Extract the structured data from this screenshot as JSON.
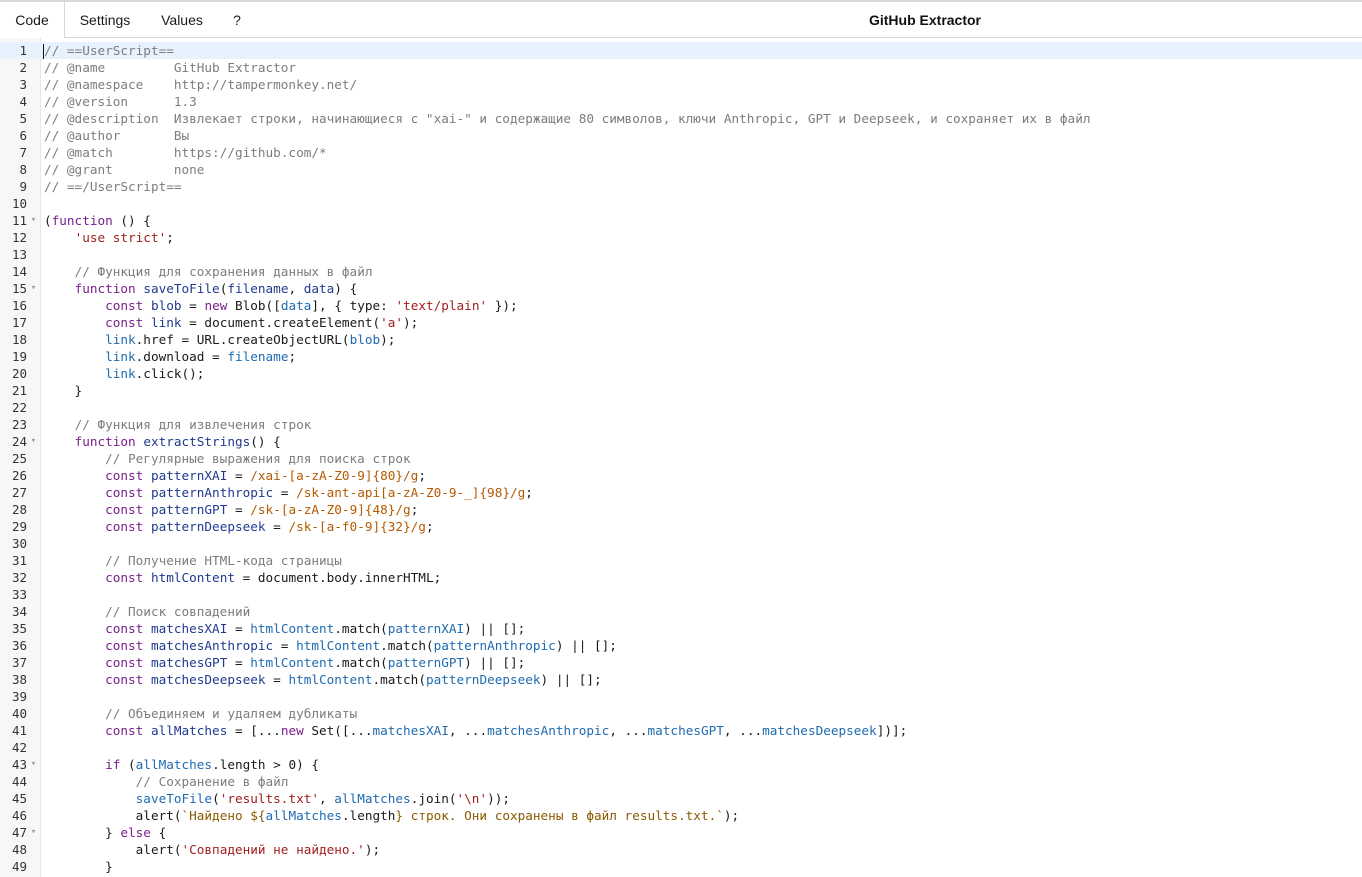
{
  "tabs": [
    {
      "label": "Code",
      "active": true
    },
    {
      "label": "Settings",
      "active": false
    },
    {
      "label": "Values",
      "active": false
    },
    {
      "label": "?",
      "active": false
    }
  ],
  "script_title": "GitHub Extractor",
  "editor": {
    "active_line": 1,
    "fold_lines": [
      11,
      15,
      24,
      43,
      47
    ],
    "lines": [
      [
        [
          "com",
          "// ==UserScript=="
        ]
      ],
      [
        [
          "com",
          "// @name         GitHub Extractor"
        ]
      ],
      [
        [
          "com",
          "// @namespace    http://tampermonkey.net/"
        ]
      ],
      [
        [
          "com",
          "// @version      1.3"
        ]
      ],
      [
        [
          "com",
          "// @description  Извлекает строки, начинающиеся с \"xai-\" и содержащие 80 символов, ключи Anthropic, GPT и Deepseek, и сохраняет их в файл"
        ]
      ],
      [
        [
          "com",
          "// @author       Вы"
        ]
      ],
      [
        [
          "com",
          "// @match        https://github.com/*"
        ]
      ],
      [
        [
          "com",
          "// @grant        none"
        ]
      ],
      [
        [
          "com",
          "// ==/UserScript=="
        ]
      ],
      [],
      [
        [
          "p",
          "("
        ],
        [
          "kw",
          "function"
        ],
        [
          "p",
          " () {"
        ]
      ],
      [
        [
          "p",
          "    "
        ],
        [
          "str",
          "'use strict'"
        ],
        [
          "p",
          ";"
        ]
      ],
      [],
      [
        [
          "p",
          "    "
        ],
        [
          "com",
          "// Функция для сохранения данных в файл"
        ]
      ],
      [
        [
          "p",
          "    "
        ],
        [
          "kw",
          "function"
        ],
        [
          "p",
          " "
        ],
        [
          "def",
          "saveToFile"
        ],
        [
          "p",
          "("
        ],
        [
          "def",
          "filename"
        ],
        [
          "p",
          ", "
        ],
        [
          "def",
          "data"
        ],
        [
          "p",
          ") {"
        ]
      ],
      [
        [
          "p",
          "        "
        ],
        [
          "kw",
          "const"
        ],
        [
          "p",
          " "
        ],
        [
          "def",
          "blob"
        ],
        [
          "p",
          " = "
        ],
        [
          "kw",
          "new"
        ],
        [
          "p",
          " Blob(["
        ],
        [
          "var",
          "data"
        ],
        [
          "p",
          "], { type: "
        ],
        [
          "str",
          "'text/plain'"
        ],
        [
          "p",
          " });"
        ]
      ],
      [
        [
          "p",
          "        "
        ],
        [
          "kw",
          "const"
        ],
        [
          "p",
          " "
        ],
        [
          "def",
          "link"
        ],
        [
          "p",
          " = document.createElement("
        ],
        [
          "str",
          "'a'"
        ],
        [
          "p",
          ");"
        ]
      ],
      [
        [
          "p",
          "        "
        ],
        [
          "var",
          "link"
        ],
        [
          "p",
          ".href = URL.createObjectURL("
        ],
        [
          "var",
          "blob"
        ],
        [
          "p",
          ");"
        ]
      ],
      [
        [
          "p",
          "        "
        ],
        [
          "var",
          "link"
        ],
        [
          "p",
          ".download = "
        ],
        [
          "var",
          "filename"
        ],
        [
          "p",
          ";"
        ]
      ],
      [
        [
          "p",
          "        "
        ],
        [
          "var",
          "link"
        ],
        [
          "p",
          ".click();"
        ]
      ],
      [
        [
          "p",
          "    }"
        ]
      ],
      [],
      [
        [
          "p",
          "    "
        ],
        [
          "com",
          "// Функция для извлечения строк"
        ]
      ],
      [
        [
          "p",
          "    "
        ],
        [
          "kw",
          "function"
        ],
        [
          "p",
          " "
        ],
        [
          "def",
          "extractStrings"
        ],
        [
          "p",
          "() {"
        ]
      ],
      [
        [
          "p",
          "        "
        ],
        [
          "com",
          "// Регулярные выражения для поиска строк"
        ]
      ],
      [
        [
          "p",
          "        "
        ],
        [
          "kw",
          "const"
        ],
        [
          "p",
          " "
        ],
        [
          "def",
          "patternXAI"
        ],
        [
          "p",
          " = "
        ],
        [
          "re",
          "/xai-[a-zA-Z0-9]{80}/g"
        ],
        [
          "p",
          ";"
        ]
      ],
      [
        [
          "p",
          "        "
        ],
        [
          "kw",
          "const"
        ],
        [
          "p",
          " "
        ],
        [
          "def",
          "patternAnthropic"
        ],
        [
          "p",
          " = "
        ],
        [
          "re",
          "/sk-ant-api[a-zA-Z0-9-_]{98}/g"
        ],
        [
          "p",
          ";"
        ]
      ],
      [
        [
          "p",
          "        "
        ],
        [
          "kw",
          "const"
        ],
        [
          "p",
          " "
        ],
        [
          "def",
          "patternGPT"
        ],
        [
          "p",
          " = "
        ],
        [
          "re",
          "/sk-[a-zA-Z0-9]{48}/g"
        ],
        [
          "p",
          ";"
        ]
      ],
      [
        [
          "p",
          "        "
        ],
        [
          "kw",
          "const"
        ],
        [
          "p",
          " "
        ],
        [
          "def",
          "patternDeepseek"
        ],
        [
          "p",
          " = "
        ],
        [
          "re",
          "/sk-[a-f0-9]{32}/g"
        ],
        [
          "p",
          ";"
        ]
      ],
      [],
      [
        [
          "p",
          "        "
        ],
        [
          "com",
          "// Получение HTML-кода страницы"
        ]
      ],
      [
        [
          "p",
          "        "
        ],
        [
          "kw",
          "const"
        ],
        [
          "p",
          " "
        ],
        [
          "def",
          "htmlContent"
        ],
        [
          "p",
          " = document.body.innerHTML;"
        ]
      ],
      [],
      [
        [
          "p",
          "        "
        ],
        [
          "com",
          "// Поиск совпадений"
        ]
      ],
      [
        [
          "p",
          "        "
        ],
        [
          "kw",
          "const"
        ],
        [
          "p",
          " "
        ],
        [
          "def",
          "matchesXAI"
        ],
        [
          "p",
          " = "
        ],
        [
          "var",
          "htmlContent"
        ],
        [
          "p",
          ".match("
        ],
        [
          "var",
          "patternXAI"
        ],
        [
          "p",
          ") || [];"
        ]
      ],
      [
        [
          "p",
          "        "
        ],
        [
          "kw",
          "const"
        ],
        [
          "p",
          " "
        ],
        [
          "def",
          "matchesAnthropic"
        ],
        [
          "p",
          " = "
        ],
        [
          "var",
          "htmlContent"
        ],
        [
          "p",
          ".match("
        ],
        [
          "var",
          "patternAnthropic"
        ],
        [
          "p",
          ") || [];"
        ]
      ],
      [
        [
          "p",
          "        "
        ],
        [
          "kw",
          "const"
        ],
        [
          "p",
          " "
        ],
        [
          "def",
          "matchesGPT"
        ],
        [
          "p",
          " = "
        ],
        [
          "var",
          "htmlContent"
        ],
        [
          "p",
          ".match("
        ],
        [
          "var",
          "patternGPT"
        ],
        [
          "p",
          ") || [];"
        ]
      ],
      [
        [
          "p",
          "        "
        ],
        [
          "kw",
          "const"
        ],
        [
          "p",
          " "
        ],
        [
          "def",
          "matchesDeepseek"
        ],
        [
          "p",
          " = "
        ],
        [
          "var",
          "htmlContent"
        ],
        [
          "p",
          ".match("
        ],
        [
          "var",
          "patternDeepseek"
        ],
        [
          "p",
          ") || [];"
        ]
      ],
      [],
      [
        [
          "p",
          "        "
        ],
        [
          "com",
          "// Объединяем и удаляем дубликаты"
        ]
      ],
      [
        [
          "p",
          "        "
        ],
        [
          "kw",
          "const"
        ],
        [
          "p",
          " "
        ],
        [
          "def",
          "allMatches"
        ],
        [
          "p",
          " = [..."
        ],
        [
          "kw",
          "new"
        ],
        [
          "p",
          " Set([..."
        ],
        [
          "var",
          "matchesXAI"
        ],
        [
          "p",
          ", ..."
        ],
        [
          "var",
          "matchesAnthropic"
        ],
        [
          "p",
          ", ..."
        ],
        [
          "var",
          "matchesGPT"
        ],
        [
          "p",
          ", ..."
        ],
        [
          "var",
          "matchesDeepseek"
        ],
        [
          "p",
          "])];"
        ]
      ],
      [],
      [
        [
          "p",
          "        "
        ],
        [
          "kw",
          "if"
        ],
        [
          "p",
          " ("
        ],
        [
          "var",
          "allMatches"
        ],
        [
          "p",
          ".length > "
        ],
        [
          "num",
          "0"
        ],
        [
          "p",
          ") {"
        ]
      ],
      [
        [
          "p",
          "            "
        ],
        [
          "com",
          "// Сохранение в файл"
        ]
      ],
      [
        [
          "p",
          "            "
        ],
        [
          "var",
          "saveToFile"
        ],
        [
          "p",
          "("
        ],
        [
          "str",
          "'results.txt'"
        ],
        [
          "p",
          ", "
        ],
        [
          "var",
          "allMatches"
        ],
        [
          "p",
          ".join("
        ],
        [
          "str",
          "'\\n'"
        ],
        [
          "p",
          "));"
        ]
      ],
      [
        [
          "p",
          "            alert("
        ],
        [
          "tpl",
          "`Найдено ${"
        ],
        [
          "var",
          "allMatches"
        ],
        [
          "p",
          ".length"
        ],
        [
          "tpl",
          "} строк. Они сохранены в файл results.txt.`"
        ],
        [
          "p",
          ");"
        ]
      ],
      [
        [
          "p",
          "        } "
        ],
        [
          "kw",
          "else"
        ],
        [
          "p",
          " {"
        ]
      ],
      [
        [
          "p",
          "            alert("
        ],
        [
          "str",
          "'Совпадений не найдено.'"
        ],
        [
          "p",
          ");"
        ]
      ],
      [
        [
          "p",
          "        }"
        ]
      ]
    ]
  }
}
